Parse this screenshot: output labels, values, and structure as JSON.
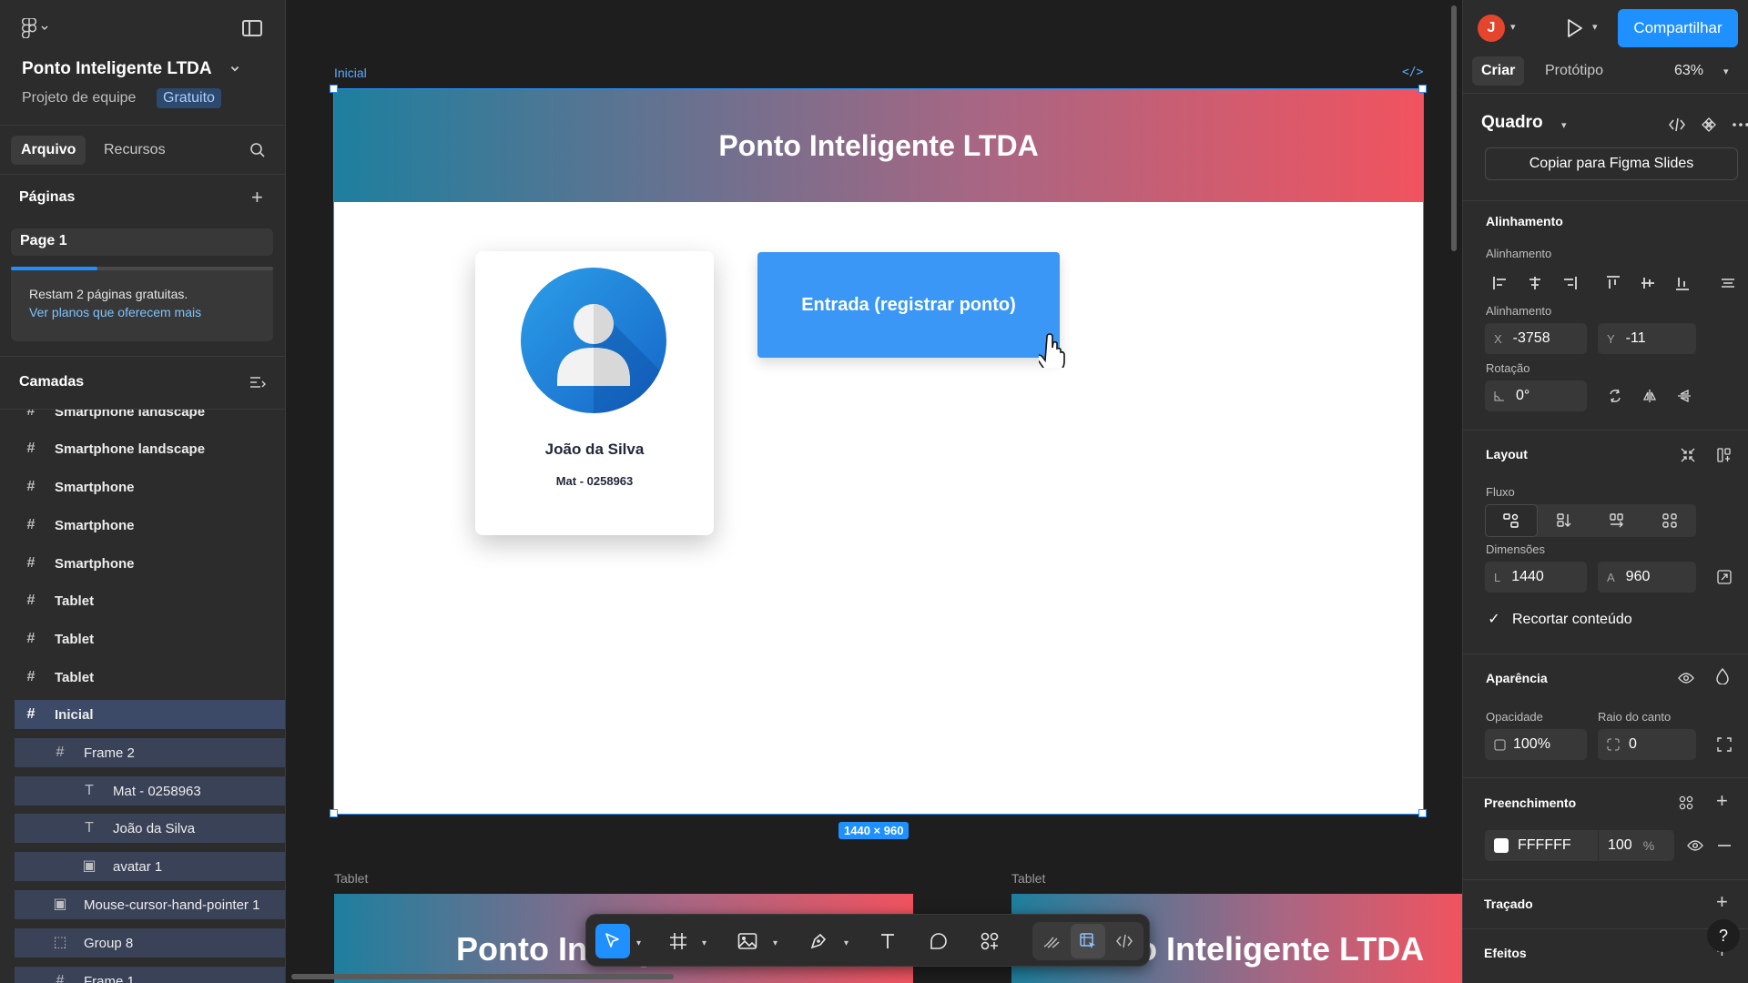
{
  "app": {
    "project_title": "Ponto Inteligente LTDA",
    "project_sub": "Projeto de equipe",
    "plan_badge": "Gratuito"
  },
  "left_tabs": {
    "file": "Arquivo",
    "assets": "Recursos"
  },
  "pages": {
    "heading": "Páginas",
    "items": [
      "Page 1"
    ],
    "upsell_text": "Restam 2 páginas gratuitas.",
    "upsell_link": "Ver planos que oferecem mais",
    "upsell_progress": 0.33
  },
  "layers": {
    "heading": "Camadas",
    "items": [
      {
        "label": "Smartphone landscape",
        "icon": "frame-icon"
      },
      {
        "label": "Smartphone landscape",
        "icon": "frame-icon"
      },
      {
        "label": "Smartphone",
        "icon": "frame-icon"
      },
      {
        "label": "Smartphone",
        "icon": "frame-icon"
      },
      {
        "label": "Smartphone",
        "icon": "frame-icon"
      },
      {
        "label": "Tablet",
        "icon": "frame-icon"
      },
      {
        "label": "Tablet",
        "icon": "frame-icon"
      },
      {
        "label": "Tablet",
        "icon": "frame-icon"
      },
      {
        "label": "Inicial",
        "icon": "frame-icon"
      },
      {
        "label": "Frame 2",
        "icon": "frame-icon"
      },
      {
        "label": "Mat - 0258963",
        "icon": "text-icon"
      },
      {
        "label": "João da Silva",
        "icon": "text-icon"
      },
      {
        "label": "avatar 1",
        "icon": "image-icon"
      },
      {
        "label": "Mouse-cursor-hand-pointer 1",
        "icon": "image-icon"
      },
      {
        "label": "Group 8",
        "icon": "group-icon"
      },
      {
        "label": "Frame 1",
        "icon": "frame-icon"
      }
    ]
  },
  "canvas": {
    "frame_label": "Inicial",
    "frame_title": "Ponto Inteligente LTDA",
    "card_name": "João da Silva",
    "card_mat": "Mat - 0258963",
    "entry_button": "Entrada (registrar ponto)",
    "size_badge": "1440 × 960",
    "tablet_label_1": "Tablet",
    "tablet_label_2": "Tablet",
    "tablet_title": "Ponto Inteligente LTDA",
    "code_tag": "</>"
  },
  "toolbar": {
    "tools": [
      "move-tool",
      "frame-tool",
      "image-tool",
      "pen-tool",
      "text-tool",
      "comment-tool",
      "components-tool",
      "draw-tool",
      "dev-inspect-tool",
      "dev-mode-tool"
    ]
  },
  "right": {
    "user_initial": "J",
    "share": "Compartilhar",
    "tab_create": "Criar",
    "tab_prototype": "Protótipo",
    "zoom": "63%",
    "frame_type": "Quadro",
    "copy_slides": "Copiar para Figma Slides",
    "alignment_heading": "Alinhamento",
    "alignment_label": "Alinhamento",
    "position_label": "Alinhamento",
    "x_prefix": "X",
    "x_value": "-3758",
    "y_prefix": "Y",
    "y_value": "-11",
    "rotation_label": "Rotação",
    "rotation_value": "0°",
    "layout_heading": "Layout",
    "flow_label": "Fluxo",
    "dimensions_label": "Dimensões",
    "w_prefix": "L",
    "w_value": "1440",
    "h_prefix": "A",
    "h_value": "960",
    "clip_label": "Recortar conteúdo",
    "appearance_heading": "Aparência",
    "opacity_label": "Opacidade",
    "opacity_value": "100%",
    "radius_label": "Raio do canto",
    "radius_value": "0",
    "fill_heading": "Preenchimento",
    "fill_hex": "FFFFFF",
    "fill_opacity": "100",
    "fill_pct": "%",
    "stroke_heading": "Traçado",
    "effects_heading": "Efeitos",
    "help": "?"
  },
  "colors": {
    "accent": "#1e90ff",
    "header_gradient_start": "#1e7f9e",
    "header_gradient_end": "#f1535f",
    "entry_button": "#3a97f5"
  }
}
